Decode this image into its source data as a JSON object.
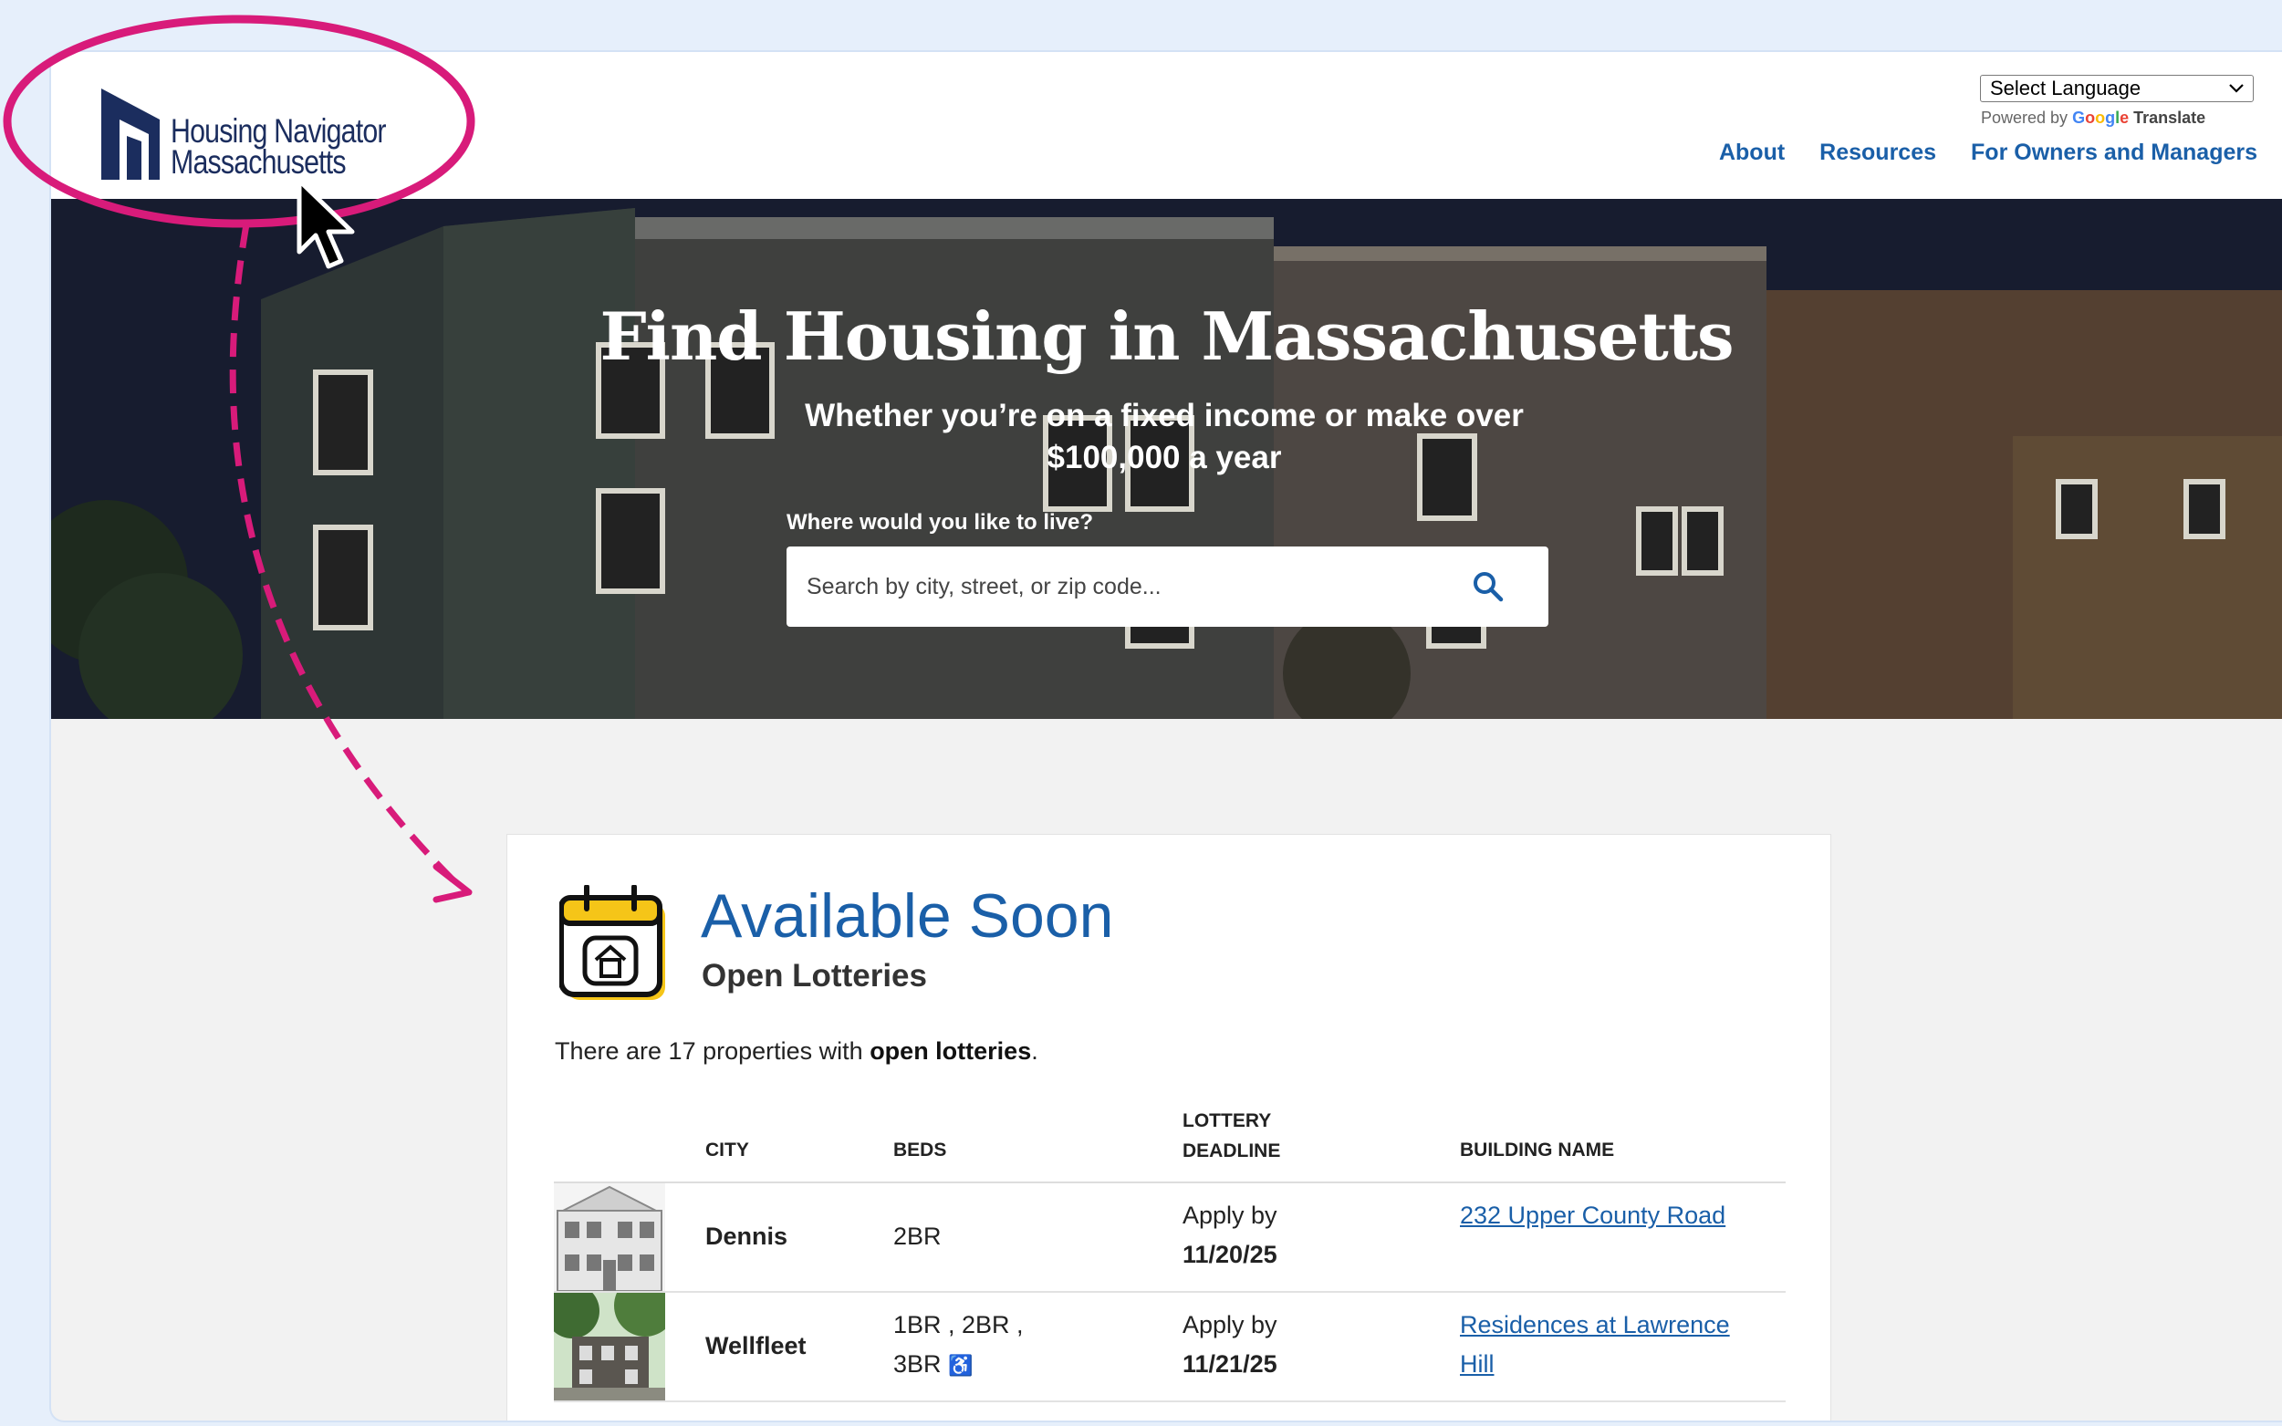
{
  "header": {
    "logo": {
      "line1": "Housing Navigator",
      "line2": "Massachusetts"
    },
    "language_select": {
      "label": "Select Language"
    },
    "powered_by": {
      "prefix": "Powered by",
      "brand": "Google",
      "product": "Translate"
    },
    "nav": [
      "About",
      "Resources",
      "For Owners and Managers"
    ]
  },
  "hero": {
    "title": "Find Housing in Massachusetts",
    "subtitle": "Whether you’re on a fixed income or make over $100,000 a year",
    "search_label": "Where would you like to live?",
    "search_placeholder": "Search by city, street, or zip code..."
  },
  "card": {
    "title": "Available Soon",
    "subtitle": "Open Lotteries",
    "summary_prefix": "There are 17 properties with ",
    "summary_bold": "open lotteries",
    "summary_suffix": ".",
    "columns": {
      "city": "CITY",
      "beds": "BEDS",
      "deadline_line1": "LOTTERY",
      "deadline_line2": "DEADLINE",
      "building": "BUILDING NAME"
    },
    "rows": [
      {
        "city": "Dennis",
        "beds_line1": "2BR",
        "beds_line2": "",
        "deadline_prefix": "Apply by",
        "deadline_date": "11/20/25",
        "building": "232 Upper County Road"
      },
      {
        "city": "Wellfleet",
        "beds_line1": "1BR , 2BR ,",
        "beds_line2": "3BR",
        "deadline_prefix": "Apply by",
        "deadline_date": "11/21/25",
        "building": "Residences at Lawrence Hill"
      }
    ]
  },
  "icons": {
    "search": "search-icon",
    "calendar": "calendar-house-icon",
    "accessible": "wheelchair-icon",
    "cursor": "mouse-pointer-icon"
  },
  "colors": {
    "brand_navy": "#1b2d5e",
    "link_blue": "#1a5fa8",
    "annotation_magenta": "#d81b7a",
    "calendar_yellow": "#f5c518"
  }
}
